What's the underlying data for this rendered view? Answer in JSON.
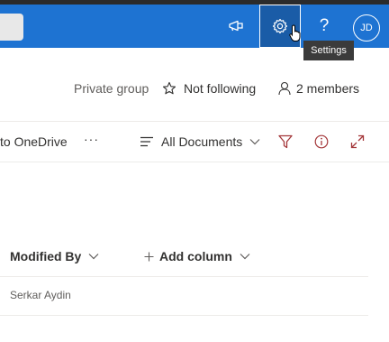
{
  "suite_bar": {
    "settings_tooltip": "Settings",
    "help_label": "?",
    "avatar_initials": "JD",
    "icons": [
      "megaphone-icon",
      "gear-icon",
      "help-icon"
    ]
  },
  "group_info": {
    "privacy": "Private group",
    "follow_label": "Not following",
    "members_label": "2 members"
  },
  "command_bar": {
    "copy_to_label": "to OneDrive",
    "more_label": "···",
    "view_label": "All Documents"
  },
  "list": {
    "columns": [
      "Modified By",
      "Add column"
    ],
    "rows": [
      {
        "modified_by": "Serkar Aydin"
      }
    ]
  },
  "colors": {
    "suite_bar": "#1e73d2",
    "accent": "#a4373a"
  }
}
